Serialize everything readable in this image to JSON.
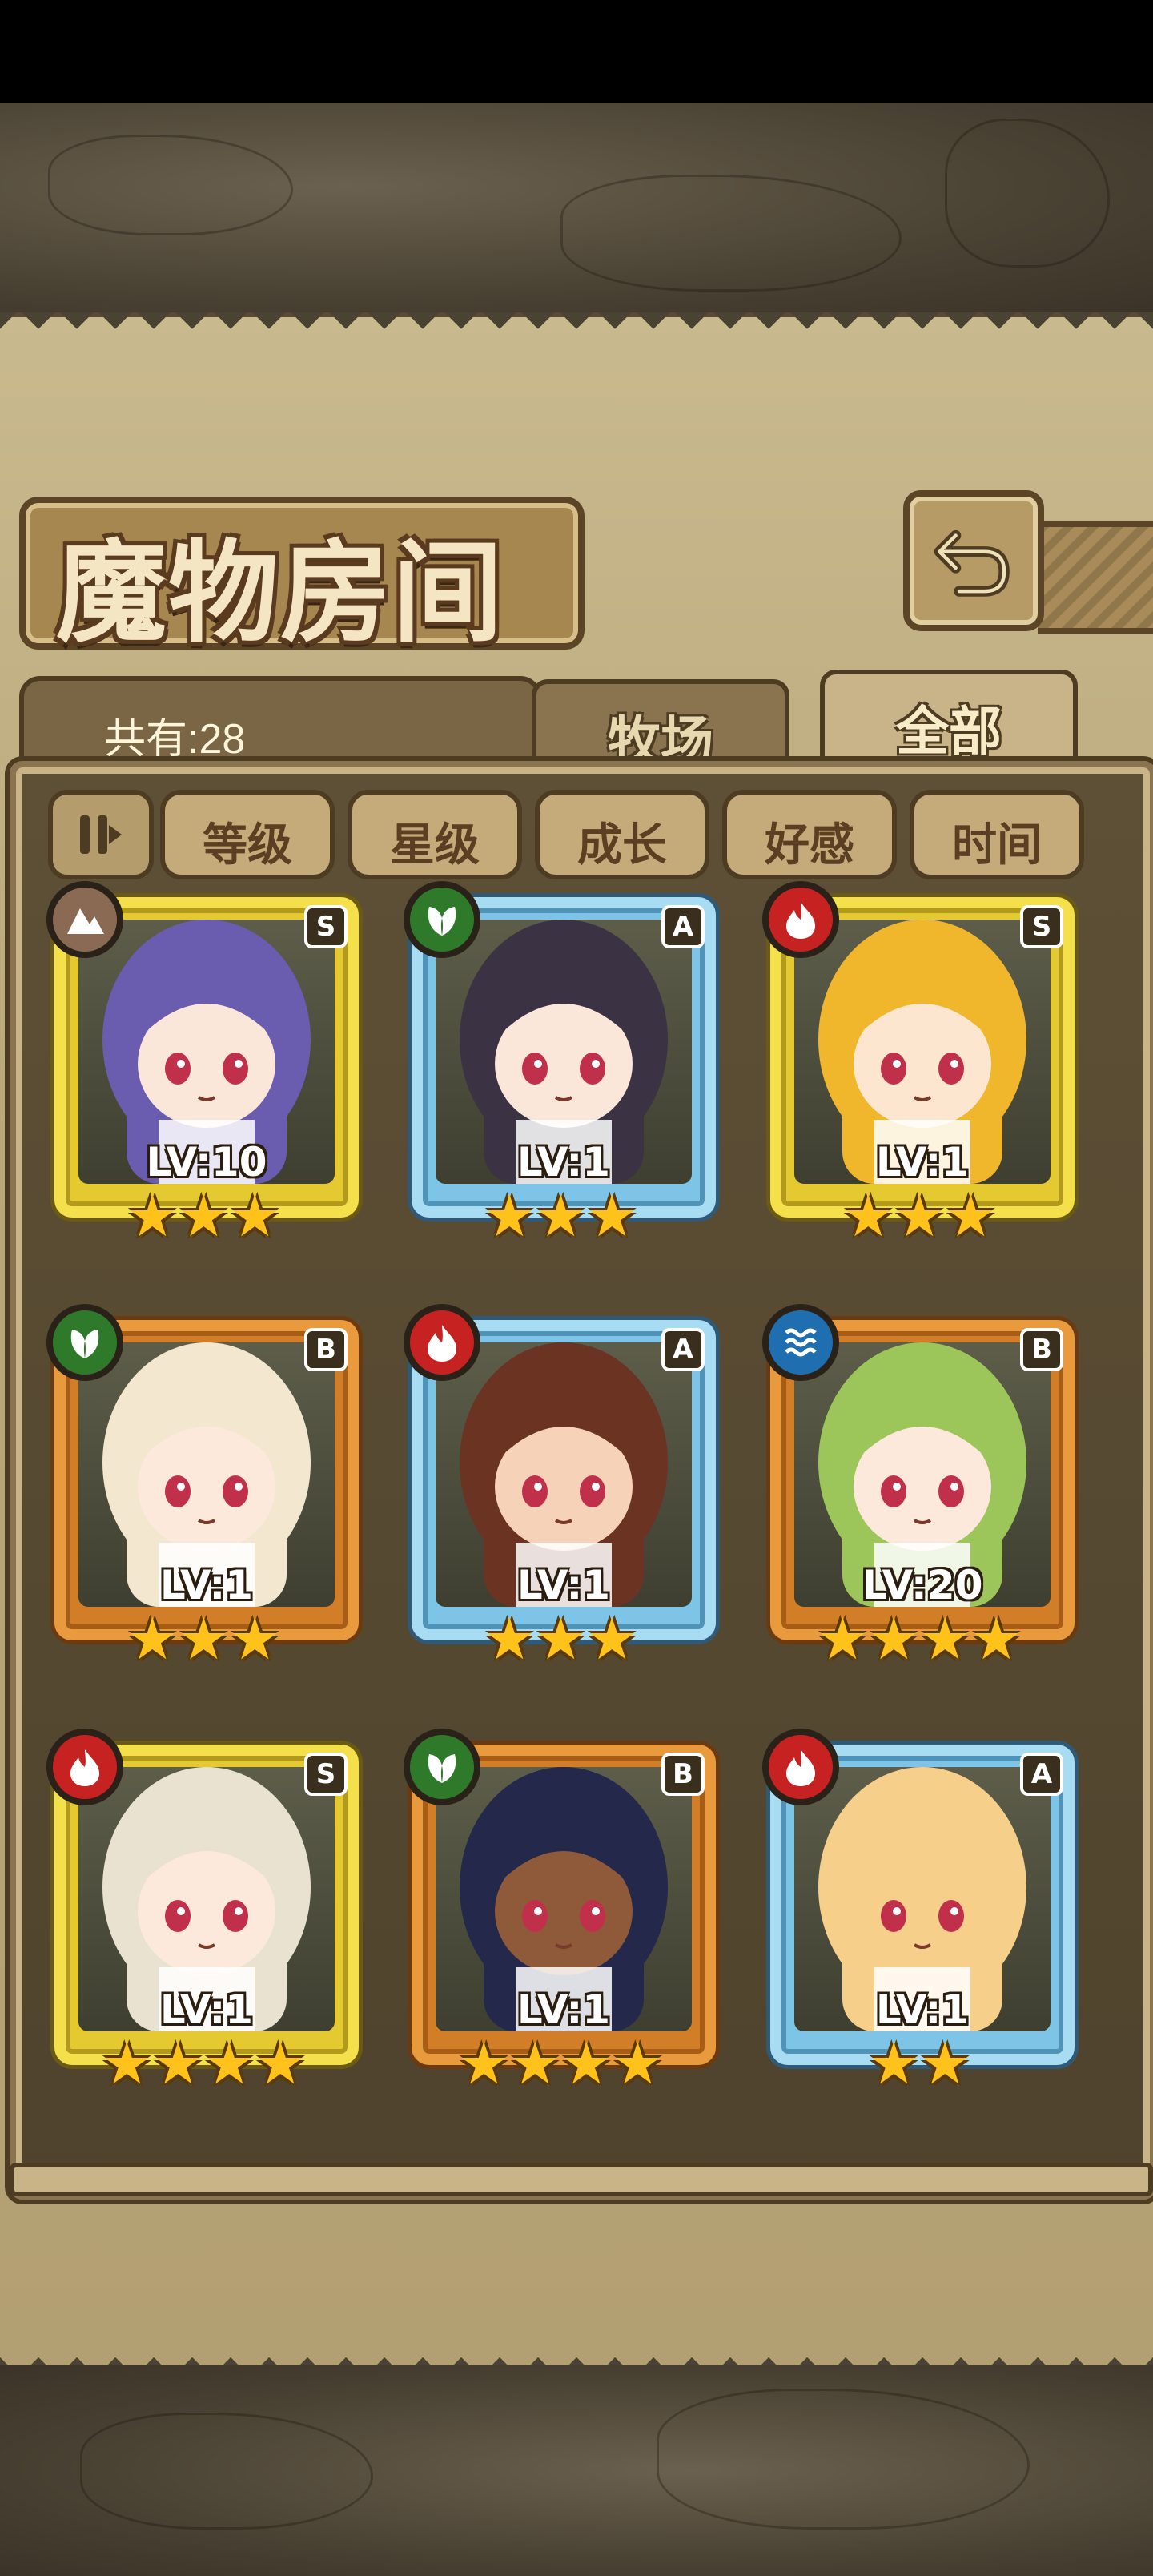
{
  "header": {
    "title": "魔物房间"
  },
  "summary": {
    "count_label": "共有:28"
  },
  "tabs": [
    {
      "label": "牧场",
      "active": false
    },
    {
      "label": "全部",
      "active": true
    }
  ],
  "sort_buttons": [
    {
      "label": "等级"
    },
    {
      "label": "星级"
    },
    {
      "label": "成长"
    },
    {
      "label": "好感"
    },
    {
      "label": "时间"
    }
  ],
  "colors": {
    "S": "#f4e04a",
    "A": "#a8dcf2",
    "B": "#e99a3c",
    "fire": "#c62222",
    "leaf": "#2f7a2a",
    "water": "#1f6fb0",
    "earth": "#8a6a52"
  },
  "monsters": [
    {
      "level_label": "LV:10",
      "rank": "S",
      "element": "earth-icon",
      "stars": 3,
      "hair": "#6a5cae",
      "skin": "#fbe6da"
    },
    {
      "level_label": "LV:1",
      "rank": "A",
      "element": "leaf-icon",
      "stars": 3,
      "hair": "#3b3344",
      "skin": "#fbe6da"
    },
    {
      "level_label": "LV:1",
      "rank": "S",
      "element": "fire-icon",
      "stars": 3,
      "hair": "#f0b62c",
      "skin": "#fde6d0"
    },
    {
      "level_label": "LV:1",
      "rank": "B",
      "element": "leaf-icon",
      "stars": 3,
      "hair": "#f3e7cf",
      "skin": "#fde9dc"
    },
    {
      "level_label": "LV:1",
      "rank": "A",
      "element": "fire-icon",
      "stars": 3,
      "hair": "#6b3322",
      "skin": "#f6d2b8"
    },
    {
      "level_label": "LV:20",
      "rank": "B",
      "element": "water-icon",
      "stars": 4,
      "hair": "#9cc55a",
      "skin": "#fde9dc"
    },
    {
      "level_label": "LV:1",
      "rank": "S",
      "element": "fire-icon",
      "stars": 4,
      "hair": "#e9e2d0",
      "skin": "#fde9dc"
    },
    {
      "level_label": "LV:1",
      "rank": "B",
      "element": "leaf-icon",
      "stars": 4,
      "hair": "#24284a",
      "skin": "#8e5a3a"
    },
    {
      "level_label": "LV:1",
      "rank": "A",
      "element": "fire-icon",
      "stars": 2,
      "hair": "#f6d08a",
      "skin": "#f6d08a"
    }
  ]
}
